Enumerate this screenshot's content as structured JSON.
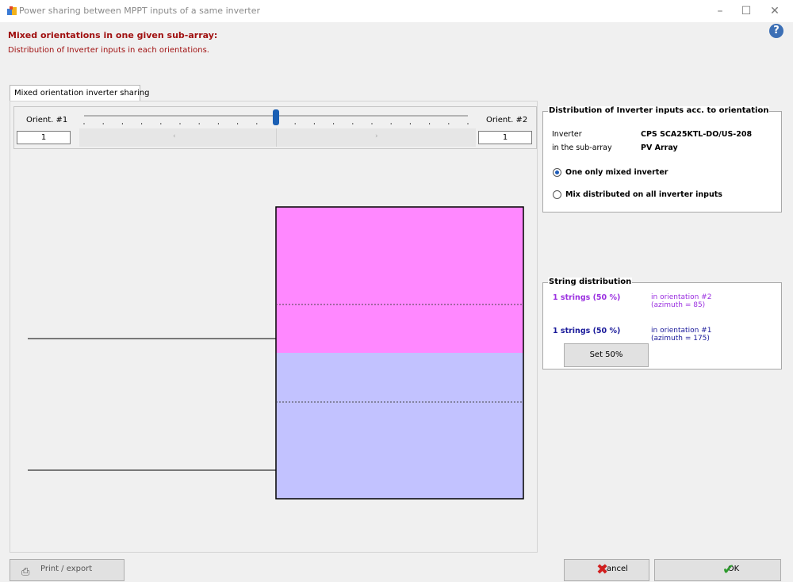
{
  "window": {
    "title": "Power sharing between MPPT inputs of a same inverter",
    "minimize": "–",
    "maximize": "☐",
    "close": "✕"
  },
  "heading": "Mixed orientations in one given sub-array:",
  "subheading": "Distribution of Inverter inputs in each orientations.",
  "help": "?",
  "tab": {
    "label": "Mixed orientation inverter sharing"
  },
  "slider": {
    "left_label": "Orient. #1",
    "right_label": "Orient. #2",
    "left_value": "1",
    "right_value": "1",
    "position": 0.5,
    "left_arrow": "‹",
    "right_arrow": "›"
  },
  "diagram": {
    "top_color": "#ff88ff",
    "bottom_color": "#c2c2ff",
    "top_fraction": 0.5
  },
  "inverter_panel": {
    "title": "Distribution of Inverter inputs acc. to orientation",
    "inverter_label": "Inverter",
    "inverter_value": "CPS SCA25KTL-DO/US-208",
    "subarray_label": "in the sub-array",
    "subarray_value": "PV Array",
    "option1": "One only mixed inverter",
    "option2": "Mix distributed on all inverter inputs",
    "selected_option": 1
  },
  "string_panel": {
    "title": "String distribution",
    "row1_count": "1 strings (50 %)",
    "row1_orient": "in orientation #2",
    "row1_azimuth": "(azimuth = 85)",
    "row1_color": "#9b30e0",
    "row2_count": "1 strings (50 %)",
    "row2_orient": "in orientation #1",
    "row2_azimuth": "(azimuth = 175)",
    "row2_color": "#1a1a9a",
    "set_button": "Set 50%"
  },
  "footer": {
    "left_button": "Print / export",
    "cancel_button": "Cancel",
    "ok_button": "OK"
  }
}
